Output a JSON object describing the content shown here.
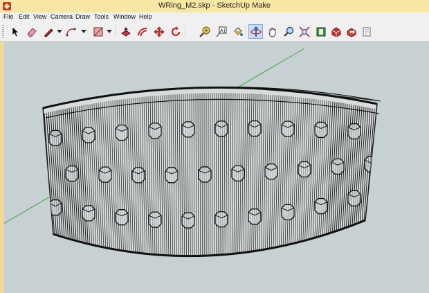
{
  "window": {
    "title": "WRing_M2.skp - SketchUp Make",
    "app_icon": "sketchup-logo-icon"
  },
  "menu": {
    "items": [
      "File",
      "Edit",
      "View",
      "Camera",
      "Draw",
      "Tools",
      "Window",
      "Help"
    ]
  },
  "toolbar": {
    "tools": [
      {
        "name": "select-tool-icon",
        "active": false
      },
      {
        "name": "eraser-tool-icon",
        "active": false
      },
      {
        "name": "pencil-line-tool-icon",
        "active": false,
        "dropdown": true
      },
      {
        "name": "arc-tool-icon",
        "active": false,
        "dropdown": true
      },
      {
        "name": "rectangle-tool-icon",
        "active": false,
        "dropdown": true
      },
      {
        "name": "push-pull-tool-icon",
        "active": false
      },
      {
        "name": "offset-tool-icon",
        "active": false
      },
      {
        "name": "move-tool-icon",
        "active": false
      },
      {
        "name": "rotate-tool-icon",
        "active": false
      },
      {
        "name": "tape-measure-tool-icon",
        "active": false
      },
      {
        "name": "text-tool-icon",
        "active": false
      },
      {
        "name": "paint-bucket-tool-icon",
        "active": false
      },
      {
        "name": "orbit-tool-icon",
        "active": true
      },
      {
        "name": "pan-tool-icon",
        "active": false
      },
      {
        "name": "zoom-tool-icon",
        "active": false
      },
      {
        "name": "zoom-extents-tool-icon",
        "active": false
      },
      {
        "name": "warehouse-tool-icon",
        "active": false
      },
      {
        "name": "extension-warehouse-icon",
        "active": false
      },
      {
        "name": "share-model-icon",
        "active": false
      },
      {
        "name": "layout-send-icon",
        "active": false
      }
    ]
  },
  "colors": {
    "titlebar": "#f7e7a3",
    "viewport_background": "#c7d1d3",
    "green_axis": "#3aa33a",
    "model_edges": "#111111",
    "model_face": "#d8dcdd"
  }
}
